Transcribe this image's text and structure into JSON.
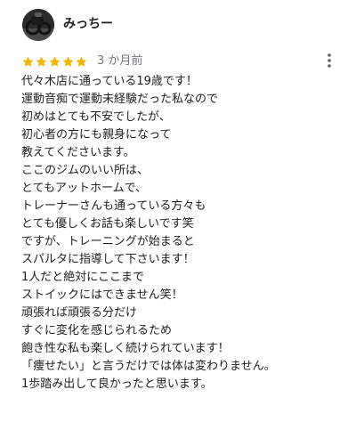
{
  "reviewer": {
    "name": "みっちー"
  },
  "rating": {
    "stars": 5,
    "max_stars": 5,
    "date": "3 か月前"
  },
  "colors": {
    "star": "#f4b400",
    "text": "#202124",
    "muted": "#70757a"
  },
  "review": {
    "lines": [
      "代々木店に通っている19歳です！",
      "運動音痴で運動未経験だった私なので",
      "初めはとても不安でしたが、",
      "初心者の方にも親身になって",
      "教えてくださいます。",
      "ここのジムのいい所は、",
      "とてもアットホームで、",
      "トレーナーさんも通っている方々も",
      "とても優しくお話も楽しいです笑",
      "ですが、トレーニングが始まると",
      "スパルタに指導して下さいます！",
      "1人だと絶対にここまで",
      "ストイックにはできません笑！",
      "頑張れば頑張る分だけ",
      "すぐに変化を感じられるため",
      "飽き性な私も楽しく続けられています！",
      "「痩せたい」と言うだけでは体は変わりません。",
      "1歩踏み出して良かったと思います。"
    ]
  }
}
